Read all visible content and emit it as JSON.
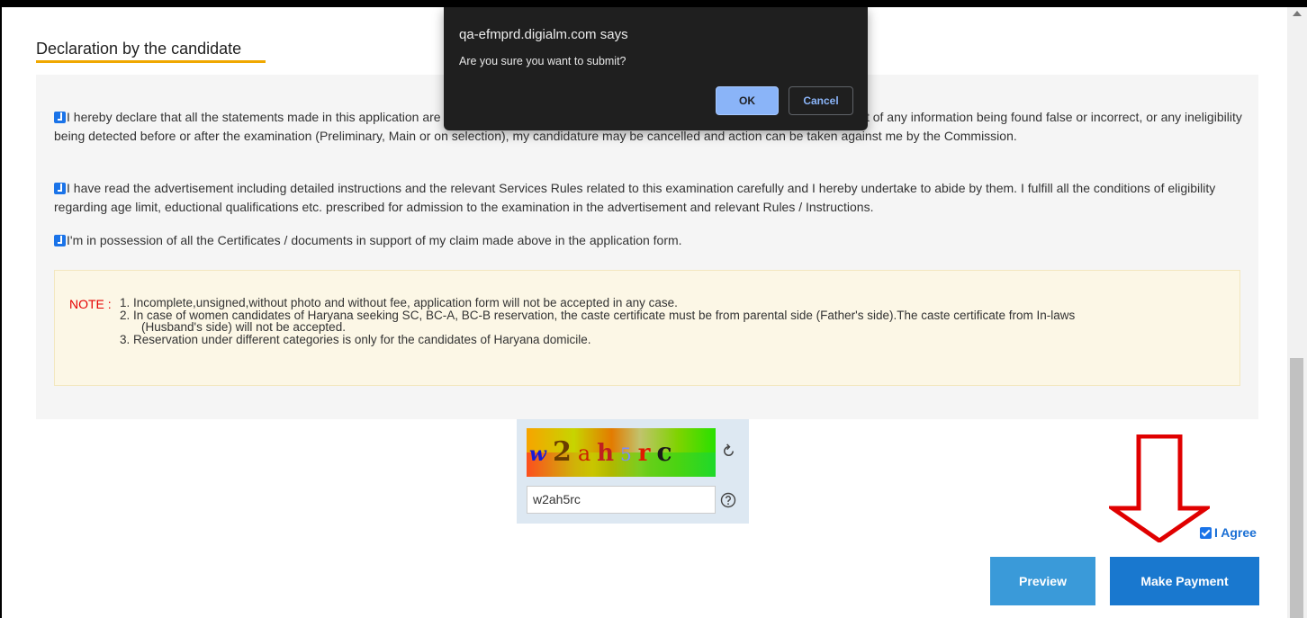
{
  "section": {
    "title": "Declaration by the candidate"
  },
  "declarations": [
    {
      "text": "I hereby declare that all the statements made in this application are true, complete and correct to the best of my knowledge & belief. In the event of any information being found false or incorrect, or any ineligibility being detected before or after the examination (Preliminary, Main or on selection), my candidature may be cancelled and action can be taken against me by the Commission.",
      "checked": true
    },
    {
      "text": "I have read the advertisement including detailed instructions and the relevant Services Rules related to this examination carefully and I hereby undertake to abide by them. I fulfill all the conditions of eligibility regarding age limit, eductional qualifications etc. prescribed for admission to the examination in the advertisement and relevant Rules / Instructions.",
      "checked": true
    },
    {
      "text": "I'm in possession of all the Certificates / documents in support of my claim made above in the application form.",
      "checked": true
    }
  ],
  "note": {
    "label": "NOTE :",
    "line1": "1. Incomplete,unsigned,without photo and without fee, application form will not be accepted in any case.",
    "line2": "2. In case of women candidates of Haryana seeking SC, BC-A, BC-B reservation, the caste certificate must be from parental side (Father's side).The caste certificate from In-laws",
    "line2_cont": "(Husband's side) will not be accepted.",
    "line3": "3. Reservation under different categories is only for the candidates of Haryana domicile."
  },
  "captcha": {
    "image_text": "w2ah5rc",
    "input_value": "w2ah5rc",
    "refresh_icon": "refresh-icon",
    "help_icon": "help-icon"
  },
  "agree": {
    "label": "I Agree",
    "checked": true
  },
  "buttons": {
    "preview": "Preview",
    "make_payment": "Make Payment"
  },
  "dialog": {
    "title": "qa-efmprd.digialm.com says",
    "message": "Are you sure you want to submit?",
    "ok": "OK",
    "cancel": "Cancel"
  },
  "annotation": {
    "arrow_color": "#e00000"
  },
  "colors": {
    "accent": "#1978cf",
    "underline": "#f0a800",
    "note_red": "#e60000"
  }
}
